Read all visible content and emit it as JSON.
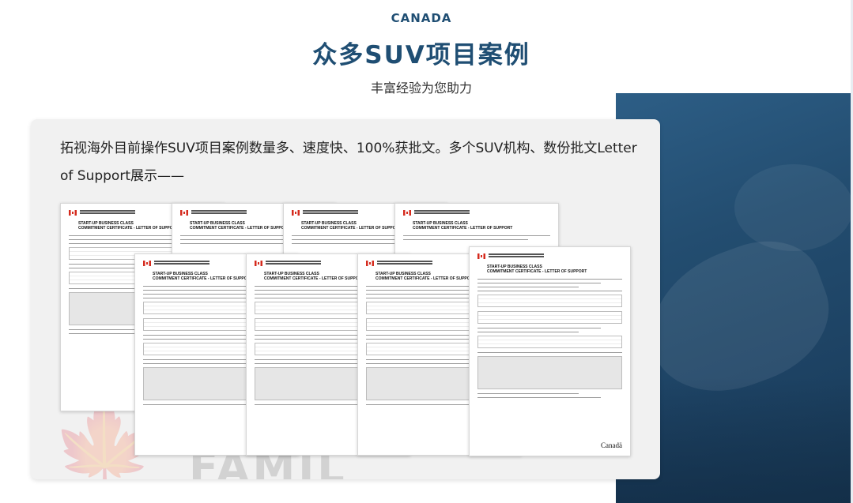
{
  "header": {
    "kicker": "CANADA",
    "title": "众多SUV项目案例",
    "subtitle": "丰富经验为您助力"
  },
  "card": {
    "description": "拓视海外目前操作SUV项目案例数量多、速度快、100%获批文。多个SUV机构、数份批文Letter of Support展示——",
    "background_word": "FAMIL"
  },
  "documents": {
    "heading_line1": "START-UP BUSINESS CLASS",
    "heading_line2": "COMMITMENT CERTIFICATE - LETTER OF SUPPORT",
    "footer_wordmark": "Canadä"
  },
  "colors": {
    "title_blue": "#1f4e73",
    "card_bg": "#f1f1f1",
    "photo_blue": "#234d70",
    "flag_red": "#d52b1e"
  }
}
